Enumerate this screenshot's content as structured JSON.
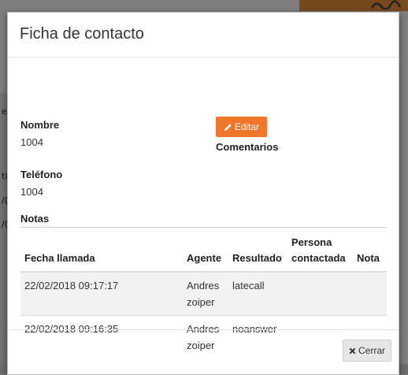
{
  "modal": {
    "title": "Ficha de contacto",
    "fields": {
      "nombre_label": "Nombre",
      "nombre_value": "1004",
      "telefono_label": "Teléfono",
      "telefono_value": "1004",
      "comentarios_label": "Comentarios",
      "notas_label": "Notas"
    },
    "edit_button": {
      "label": "Editar",
      "icon": "pencil-icon"
    },
    "close_button": {
      "label": "Cerrar",
      "icon": "close-icon"
    },
    "table": {
      "headers": [
        "Fecha llamada",
        "Agente",
        "Resultado",
        "Persona contactada",
        "Nota"
      ],
      "rows": [
        {
          "fecha": "22/02/2018 09:17:17",
          "agente": "Andres zoiper",
          "resultado": "latecall",
          "persona": "",
          "nota": ""
        },
        {
          "fecha": "22/02/2018 09:16:35",
          "agente": "Andres zoiper",
          "resultado": "noanswer",
          "persona": "",
          "nota": ""
        }
      ]
    }
  },
  "background": {
    "fragments": [
      "e",
      "ti",
      "/(",
      "/("
    ]
  },
  "colors": {
    "accent": "#f0762b",
    "overlay": "#000000",
    "stripe": "#f2f2f2"
  }
}
